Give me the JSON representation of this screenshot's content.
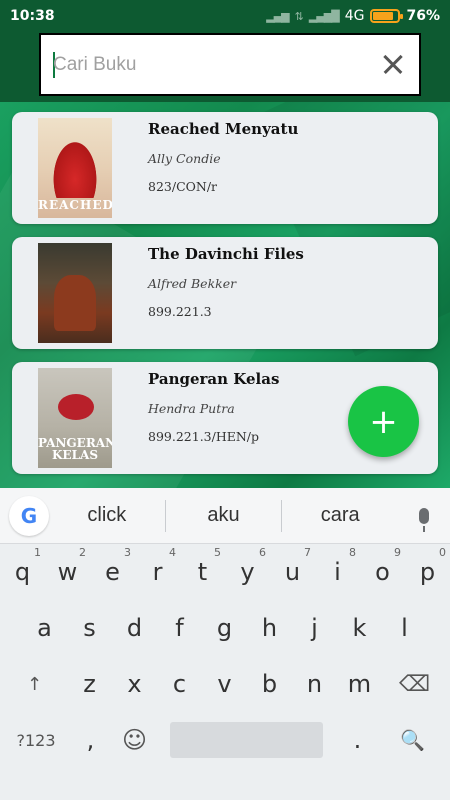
{
  "status": {
    "time": "10:38",
    "network": "4G",
    "battery": "76%",
    "battery_level": 0.76
  },
  "search": {
    "placeholder": "Cari Buku",
    "value": ""
  },
  "books": [
    {
      "title": "Reached Menyatu",
      "author": "Ally Condie",
      "code": "823/CON/r",
      "cover_text": "REACHED"
    },
    {
      "title": "The Davinchi Files",
      "author": "Alfred Bekker",
      "code": "899.221.3",
      "cover_text": ""
    },
    {
      "title": "Pangeran Kelas",
      "author": "Hendra Putra",
      "code": "899.221.3/HEN/p",
      "cover_text": "PANGERAN KELAS"
    }
  ],
  "fab": {
    "icon": "plus-icon",
    "label": "+"
  },
  "keyboard": {
    "suggestions": [
      "click",
      "aku",
      "cara"
    ],
    "row1": [
      "q",
      "w",
      "e",
      "r",
      "t",
      "y",
      "u",
      "i",
      "o",
      "p"
    ],
    "row1_hints": [
      "1",
      "2",
      "3",
      "4",
      "5",
      "6",
      "7",
      "8",
      "9",
      "0"
    ],
    "row2": [
      "a",
      "s",
      "d",
      "f",
      "g",
      "h",
      "j",
      "k",
      "l"
    ],
    "row3": [
      "↑",
      "z",
      "x",
      "c",
      "v",
      "b",
      "n",
      "m",
      "⌫"
    ],
    "row4": {
      "symbols": "?123",
      "comma": ",",
      "emoji": "☺",
      "period": ".",
      "search": "🔍"
    }
  },
  "colors": {
    "header": "#0d5a31",
    "accent": "#19c445",
    "card": "#eceff2"
  }
}
